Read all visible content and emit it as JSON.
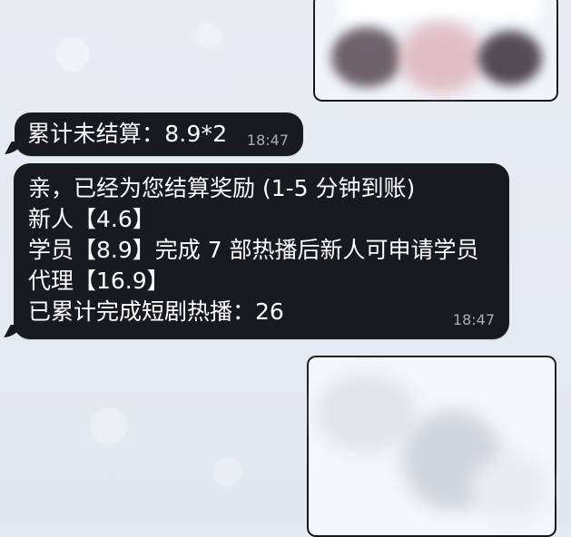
{
  "chat": {
    "messages": [
      {
        "kind": "text",
        "lines": [
          "累计未结算：8.9*2"
        ],
        "time": "18:47"
      },
      {
        "kind": "text",
        "lines": [
          "亲，已经为您结算奖励 (1-5 分钟到账)",
          "新人【4.6】",
          "学员【8.9】完成 7 部热播后新人可申请学员",
          "代理【16.9】",
          "已累计完成短剧热播：26"
        ],
        "time": "18:47"
      }
    ]
  },
  "colors": {
    "background": "#e6ebf2",
    "incoming_bubble": "#191a1f",
    "incoming_text": "#ffffff",
    "timestamp": "#a7acb7"
  },
  "icons": {
    "blurred_image_top": "image-blurred-icon",
    "blurred_image_bottom": "image-blurred-icon"
  }
}
